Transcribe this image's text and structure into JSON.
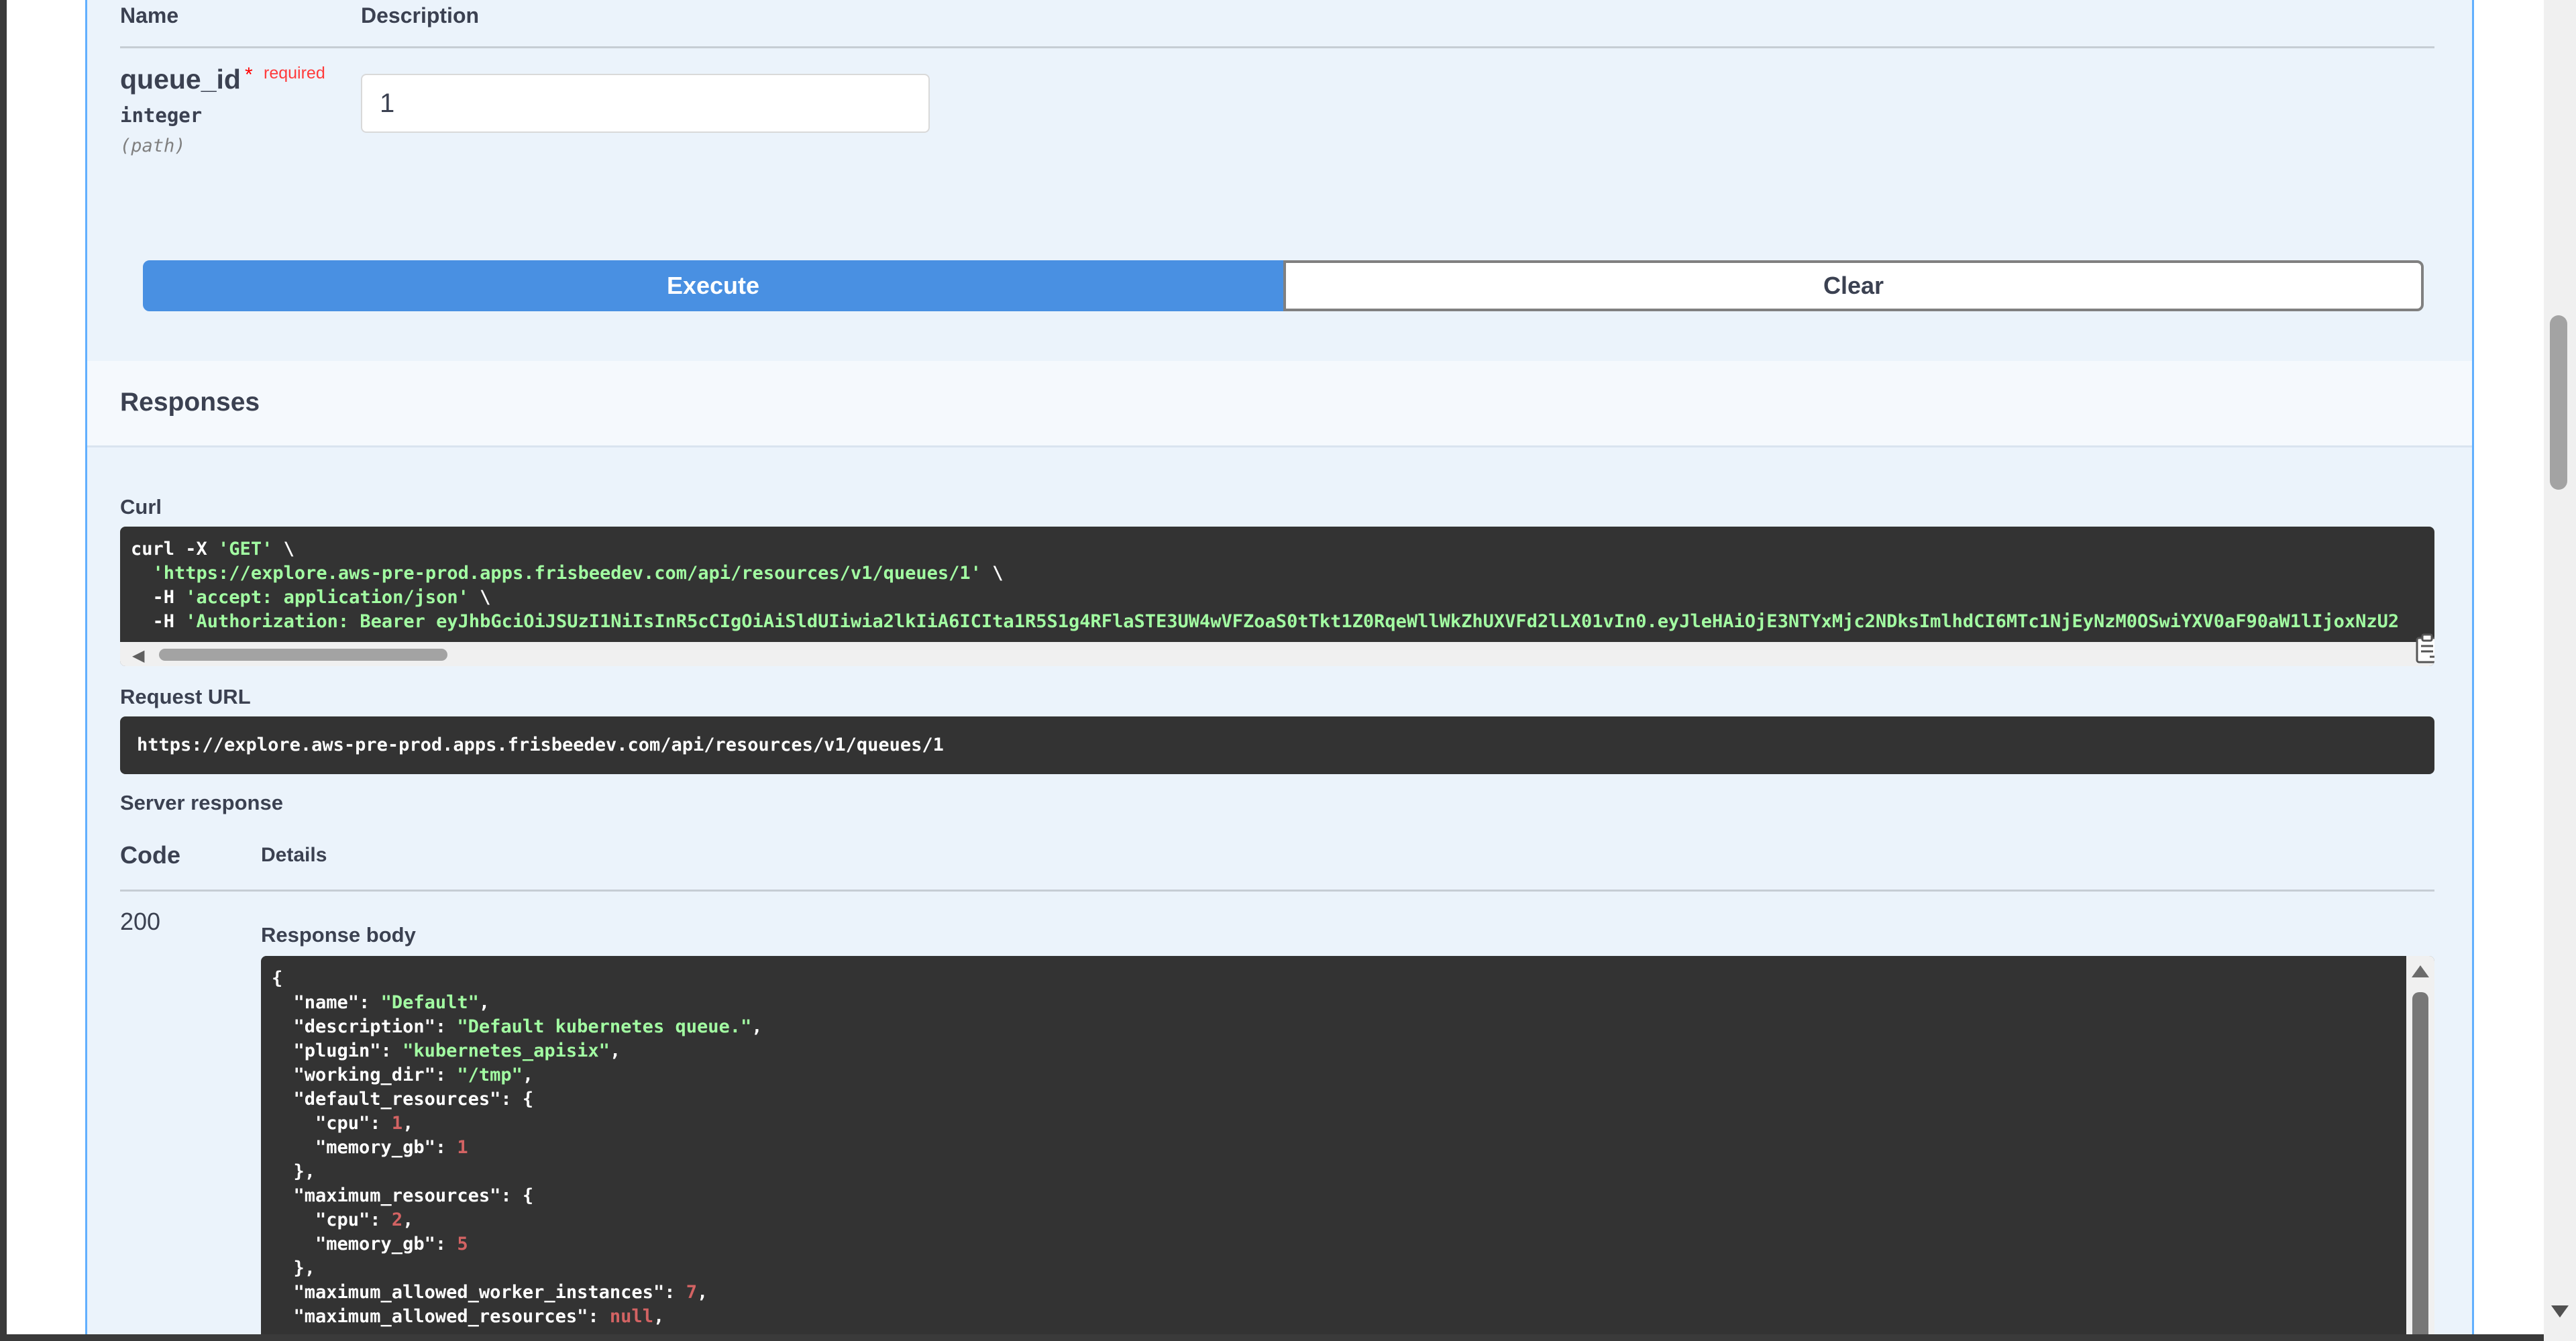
{
  "params": {
    "header_name": "Name",
    "header_description": "Description",
    "param_name": "queue_id",
    "required_star": "*",
    "required_label": "required",
    "param_type": "integer",
    "param_in": "(path)",
    "param_value": "1"
  },
  "actions": {
    "execute_label": "Execute",
    "clear_label": "Clear"
  },
  "responses": {
    "title": "Responses",
    "curl_label": "Curl",
    "curl_lines": [
      [
        "curl -X ",
        "'GET'",
        " \\"
      ],
      [
        "  ",
        "'https://explore.aws-pre-prod.apps.frisbeedev.com/api/resources/v1/queues/1'",
        " \\"
      ],
      [
        "  -H ",
        "'accept: application/json'",
        " \\"
      ],
      [
        "  -H ",
        "'Authorization: Bearer eyJhbGciOiJSUzI1NiIsInR5cCIgOiAiSldUIiwia2lkIiA6ICIta1R5S1g4RFlaSTE3UW4wVFZoaS0tTkt1Z0RqeWllWkZhUXVFd2lLX01vIn0.eyJleHAiOjE3NTYxMjc2NDksImlhdCI6MTc1NjEyNzM0OSwiYXV0aF90aW1lIjoxNzU2",
        ""
      ]
    ],
    "request_url_label": "Request URL",
    "request_url": "https://explore.aws-pre-prod.apps.frisbeedev.com/api/resources/v1/queues/1",
    "server_response_label": "Server response",
    "code_header": "Code",
    "details_header": "Details",
    "status_code": "200",
    "response_body_label": "Response body",
    "body_lines": [
      [
        [
          "p",
          "{"
        ]
      ],
      [
        [
          "p",
          "  \"name\": "
        ],
        [
          "s",
          "\"Default\""
        ],
        [
          "p",
          ","
        ]
      ],
      [
        [
          "p",
          "  \"description\": "
        ],
        [
          "s",
          "\"Default kubernetes queue.\""
        ],
        [
          "p",
          ","
        ]
      ],
      [
        [
          "p",
          "  \"plugin\": "
        ],
        [
          "s",
          "\"kubernetes_apisix\""
        ],
        [
          "p",
          ","
        ]
      ],
      [
        [
          "p",
          "  \"working_dir\": "
        ],
        [
          "s",
          "\"/tmp\""
        ],
        [
          "p",
          ","
        ]
      ],
      [
        [
          "p",
          "  \"default_resources\": {"
        ]
      ],
      [
        [
          "p",
          "    \"cpu\": "
        ],
        [
          "n",
          "1"
        ],
        [
          "p",
          ","
        ]
      ],
      [
        [
          "p",
          "    \"memory_gb\": "
        ],
        [
          "n",
          "1"
        ]
      ],
      [
        [
          "p",
          "  },"
        ]
      ],
      [
        [
          "p",
          "  \"maximum_resources\": {"
        ]
      ],
      [
        [
          "p",
          "    \"cpu\": "
        ],
        [
          "n",
          "2"
        ],
        [
          "p",
          ","
        ]
      ],
      [
        [
          "p",
          "    \"memory_gb\": "
        ],
        [
          "n",
          "5"
        ]
      ],
      [
        [
          "p",
          "  },"
        ]
      ],
      [
        [
          "p",
          "  \"maximum_allowed_worker_instances\": "
        ],
        [
          "n",
          "7"
        ],
        [
          "p",
          ","
        ]
      ],
      [
        [
          "p",
          "  \"maximum_allowed_resources\": "
        ],
        [
          "n",
          "null"
        ],
        [
          "p",
          ","
        ]
      ]
    ]
  }
}
